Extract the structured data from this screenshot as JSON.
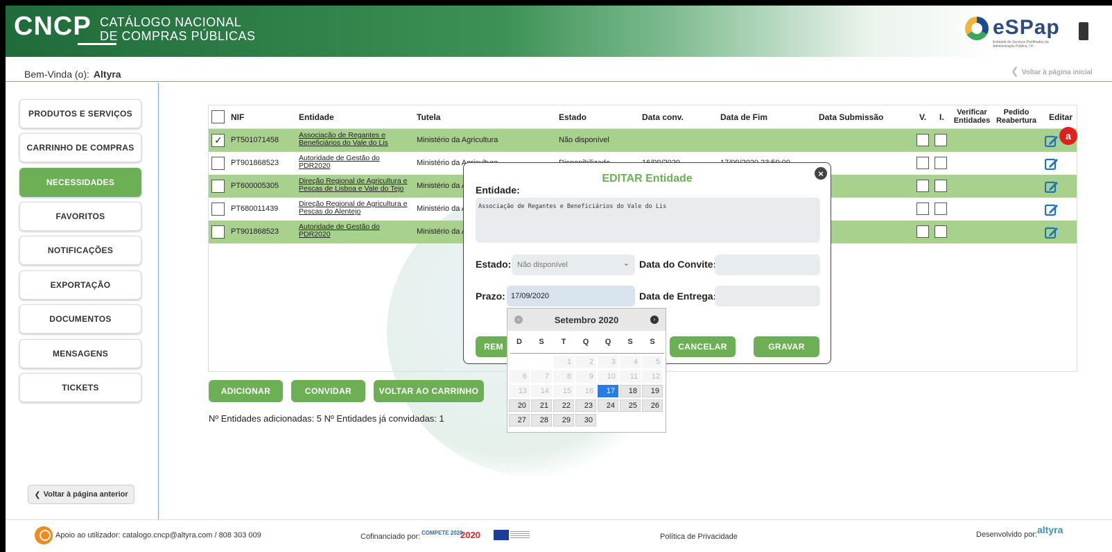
{
  "header": {
    "logo_main": "CNCP",
    "logo_line1": "CATÁLOGO NACIONAL",
    "logo_line2": "DE COMPRAS PÚBLICAS",
    "partner_logo": "eSPap",
    "partner_small": "Entidade de Serviços Partilhados da Administração Pública, I.P."
  },
  "welcome": {
    "prefix": "Bem-Vinda (o):",
    "user": "Altyra",
    "back_home": "Voltar à página inicial"
  },
  "sidebar": {
    "items": [
      {
        "label": "PRODUTOS E SERVIÇOS",
        "active": false
      },
      {
        "label": "CARRINHO DE COMPRAS",
        "active": false
      },
      {
        "label": "NECESSIDADES",
        "active": true
      },
      {
        "label": "FAVORITOS",
        "active": false
      },
      {
        "label": "NOTIFICAÇÕES",
        "active": false
      },
      {
        "label": "EXPORTAÇÃO",
        "active": false
      },
      {
        "label": "DOCUMENTOS",
        "active": false
      },
      {
        "label": "MENSAGENS",
        "active": false
      },
      {
        "label": "TICKETS",
        "active": false
      }
    ],
    "back_label": "Voltar à página anterior"
  },
  "table": {
    "headers": {
      "nif": "NIF",
      "entidade": "Entidade",
      "tutela": "Tutela",
      "estado": "Estado",
      "data_conv": "Data conv.",
      "data_fim": "Data de Fim",
      "data_sub": "Data Submissão",
      "v": "V.",
      "i": "I.",
      "verificar_1": "Verificar",
      "verificar_2": "Entidades",
      "pedido_1": "Pedido",
      "pedido_2": "Reabertura",
      "editar": "Editar"
    },
    "rows": [
      {
        "checked": true,
        "nif": "PT501071458",
        "ent1": "Associação de Regantes e",
        "ent2": "Beneficiários do Vale do Lis",
        "tutela": "Ministério da Agricultura",
        "estado": "Não disponível",
        "data_conv": "",
        "data_fim": ""
      },
      {
        "checked": false,
        "nif": "PT901868523",
        "ent1": "Autoridade de Gestão do",
        "ent2": "PDR2020",
        "tutela": "Ministério da Agricultura",
        "estado": "Disponibilizado",
        "data_conv": "16/09/2020",
        "data_fim": "17/09/2020 23:59:00"
      },
      {
        "checked": false,
        "nif": "PT600005305",
        "ent1": "Direção Regional de Agricultura e",
        "ent2": "Pescas de Lisboa e Vale do Tejo",
        "tutela": "Ministério da A",
        "estado": "",
        "data_conv": "",
        "data_fim": ""
      },
      {
        "checked": false,
        "nif": "PT680011439",
        "ent1": "Direção Regional de Agricultura e",
        "ent2": "Pescas do Alentejo",
        "tutela": "Ministério da A",
        "estado": "",
        "data_conv": "",
        "data_fim": ""
      },
      {
        "checked": false,
        "nif": "PT901868523",
        "ent1": "Autoridade de Gestão do",
        "ent2": "PDR2020",
        "tutela": "Ministério da A",
        "estado": "",
        "data_conv": "",
        "data_fim": ""
      }
    ],
    "badge": "a"
  },
  "actions": {
    "add": "ADICIONAR",
    "invite": "CONVIDAR",
    "back_cart": "VOLTAR AO CARRINHO"
  },
  "counts": "Nº Entidades adicionadas: 5 Nº Entidades já convidadas: 1",
  "modal": {
    "title": "EDITAR Entidade",
    "close": "×",
    "entidade_label": "Entidade:",
    "entidade_value": "Associação de Regantes e Beneficiários do Vale do Lis",
    "estado_label": "Estado:",
    "estado_value": "Não disponível",
    "data_convite_label": "Data do Convite:",
    "data_convite_value": "",
    "prazo_label": "Prazo:",
    "prazo_value": "17/09/2020",
    "data_entrega_label": "Data de Entrega:",
    "data_entrega_value": "",
    "remove_label": "REM",
    "cancel_label": "CANCELAR",
    "save_label": "GRAVAR"
  },
  "calendar": {
    "title": "Setembro 2020",
    "prev": "‹",
    "next": "›",
    "dow": [
      "D",
      "S",
      "T",
      "Q",
      "Q",
      "S",
      "S"
    ],
    "weeks": [
      [
        "",
        "",
        "1",
        "2",
        "3",
        "4",
        "5"
      ],
      [
        "6",
        "7",
        "8",
        "9",
        "10",
        "11",
        "12"
      ],
      [
        "13",
        "14",
        "15",
        "16",
        "17",
        "18",
        "19"
      ],
      [
        "20",
        "21",
        "22",
        "23",
        "24",
        "25",
        "26"
      ],
      [
        "27",
        "28",
        "29",
        "30",
        "",
        "",
        ""
      ]
    ],
    "selected": "17",
    "first_enabled": 17
  },
  "footer": {
    "support": "Apoio ao utilizador: catalogo.cncp@altyra.com / 808 303 009",
    "cofinanced": "Cofinanciado por:",
    "compete": "COMPETE 2020",
    "portugal2020": "2020",
    "privacy": "Política de Privacidade",
    "developed": "Desenvolvido por:",
    "altyra_logo": "altyra"
  },
  "colors": {
    "brand_green": "#6daf55",
    "row_green": "#a9d18e",
    "header_green": "#1f6b3a",
    "selected_day": "#2b7be6",
    "edit_blue": "#1e73be"
  }
}
